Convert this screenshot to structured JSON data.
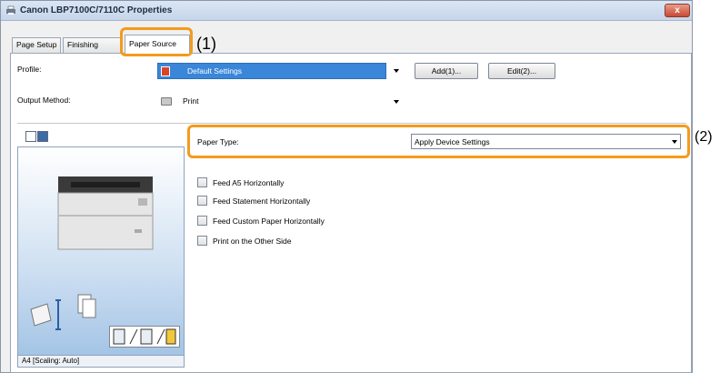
{
  "window": {
    "title": "Canon LBP7100C/7110C Properties",
    "close_label": "x"
  },
  "tabs": [
    {
      "label": "Page Setup"
    },
    {
      "label": "Finishing"
    },
    {
      "label": "Paper Source"
    }
  ],
  "annotations": {
    "tab_marker": "(1)",
    "paper_type_marker": "(2)"
  },
  "profile": {
    "label": "Profile:",
    "value": "Default Settings",
    "add_button": "Add(1)...",
    "edit_button": "Edit(2)..."
  },
  "output_method": {
    "label": "Output Method:",
    "value": "Print"
  },
  "paper_type": {
    "label": "Paper Type:",
    "value": "Apply Device Settings"
  },
  "checkboxes": [
    {
      "label": "Feed A5 Horizontally",
      "checked": false
    },
    {
      "label": "Feed Statement Horizontally",
      "checked": false
    },
    {
      "label": "Feed Custom Paper Horizontally",
      "checked": false
    },
    {
      "label": "Print on the Other Side",
      "checked": false
    }
  ],
  "preview": {
    "caption": "A4 [Scaling: Auto]"
  },
  "colors": {
    "highlight": "#f49b1d",
    "selection": "#3a86d8"
  }
}
